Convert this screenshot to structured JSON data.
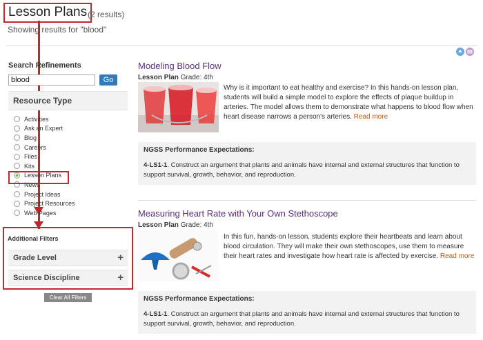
{
  "header": {
    "title": "Lesson Plans",
    "result_count": "(2 results)",
    "showing": "Showing results for \"blood\""
  },
  "sidebar": {
    "refine_title": "Search Refinements",
    "search_value": "blood",
    "go_label": "Go",
    "resource_type_label": "Resource Type",
    "resource_types": [
      {
        "label": "Activities",
        "checked": false
      },
      {
        "label": "Ask an Expert",
        "checked": false
      },
      {
        "label": "Blog",
        "checked": false
      },
      {
        "label": "Careers",
        "checked": false
      },
      {
        "label": "Files",
        "checked": false
      },
      {
        "label": "Kits",
        "checked": false
      },
      {
        "label": "Lesson Plans",
        "checked": true
      },
      {
        "label": "News",
        "checked": false
      },
      {
        "label": "Project Ideas",
        "checked": false
      },
      {
        "label": "Project Resources",
        "checked": false
      },
      {
        "label": "Web Pages",
        "checked": false
      }
    ],
    "additional_filters_label": "Additional Filters",
    "filters": [
      {
        "label": "Grade Level",
        "icon": "plus"
      },
      {
        "label": "Science Discipline",
        "icon": "plus"
      }
    ],
    "clear_label": "Clear All Filters"
  },
  "share_icons": [
    "print-icon",
    "email-icon"
  ],
  "results": [
    {
      "title": "Modeling Blood Flow",
      "type": "Lesson Plan",
      "grade": "Grade: 4th",
      "description": "Why is it important to eat healthy and exercise? In this hands-on lesson plan, students will build a simple model to explore the effects of plaque buildup in arteries. The model allows them to demonstrate what happens to blood flow when heart disease narrows a person's arteries.",
      "read_more": "Read more",
      "ngss_title": "NGSS Performance Expectations:",
      "ngss_code": "4-LS1-1",
      "ngss_text": ". Construct an argument that plants and animals have internal and external structures that function to support survival, growth, behavior, and reproduction."
    },
    {
      "title": "Measuring Heart Rate with Your Own Stethoscope",
      "type": "Lesson Plan",
      "grade": "Grade: 4th",
      "description": "In this fun, hands-on lesson, students explore their heartbeats and learn about blood circulation. They will make their own stethoscopes, use them to measure their heart rates and investigate how heart rate is affected by exercise.",
      "read_more": "Read more",
      "ngss_title": "NGSS Performance Expectations:",
      "ngss_code": "4-LS1-1",
      "ngss_text": ". Construct an argument that plants and animals have internal and external structures that function to support survival, growth, behavior, and reproduction."
    }
  ],
  "colors": {
    "annotation_red": "#c1272d",
    "title_purple": "#5b2d83",
    "read_more": "#c55a11",
    "go_button": "#337ab7"
  }
}
